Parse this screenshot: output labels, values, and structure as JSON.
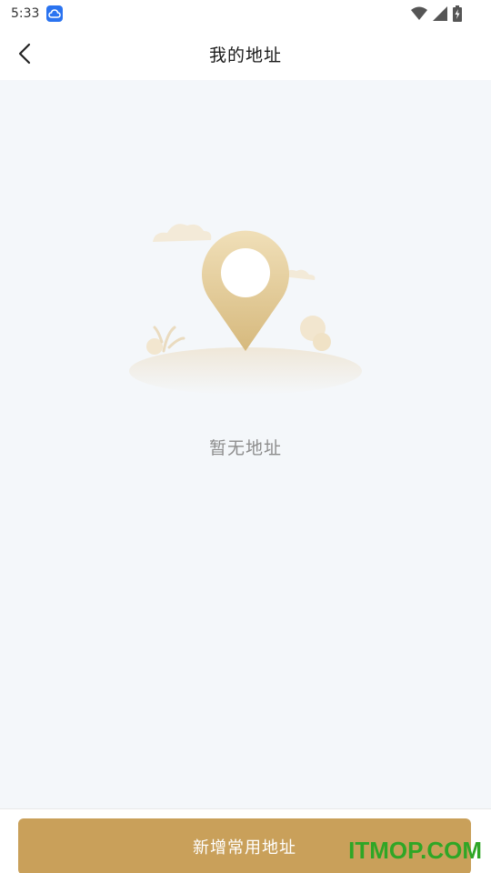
{
  "status_bar": {
    "time": "5:33",
    "icons": [
      "cloud-app-icon",
      "wifi-icon",
      "cell-signal-icon",
      "battery-charging-icon"
    ]
  },
  "header": {
    "back_icon": "chevron-left-icon",
    "title": "我的地址"
  },
  "empty_state": {
    "illustration": "location-pin-icon",
    "message": "暂无地址"
  },
  "bottom": {
    "add_button_label": "新增常用地址"
  },
  "watermark": {
    "text": "ITMOP.COM"
  },
  "colors": {
    "accent": "#c9a05a",
    "background": "#f4f7fa",
    "watermark": "#2fa626"
  }
}
